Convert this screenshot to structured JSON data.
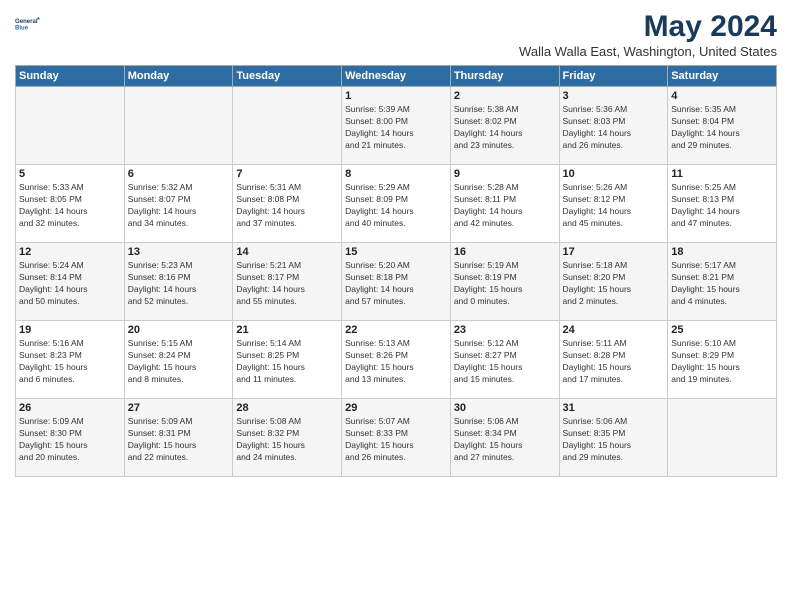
{
  "logo": {
    "line1": "General",
    "line2": "Blue"
  },
  "title": "May 2024",
  "location": "Walla Walla East, Washington, United States",
  "weekdays": [
    "Sunday",
    "Monday",
    "Tuesday",
    "Wednesday",
    "Thursday",
    "Friday",
    "Saturday"
  ],
  "weeks": [
    [
      {
        "day": "",
        "content": ""
      },
      {
        "day": "",
        "content": ""
      },
      {
        "day": "",
        "content": ""
      },
      {
        "day": "1",
        "content": "Sunrise: 5:39 AM\nSunset: 8:00 PM\nDaylight: 14 hours\nand 21 minutes."
      },
      {
        "day": "2",
        "content": "Sunrise: 5:38 AM\nSunset: 8:02 PM\nDaylight: 14 hours\nand 23 minutes."
      },
      {
        "day": "3",
        "content": "Sunrise: 5:36 AM\nSunset: 8:03 PM\nDaylight: 14 hours\nand 26 minutes."
      },
      {
        "day": "4",
        "content": "Sunrise: 5:35 AM\nSunset: 8:04 PM\nDaylight: 14 hours\nand 29 minutes."
      }
    ],
    [
      {
        "day": "5",
        "content": "Sunrise: 5:33 AM\nSunset: 8:05 PM\nDaylight: 14 hours\nand 32 minutes."
      },
      {
        "day": "6",
        "content": "Sunrise: 5:32 AM\nSunset: 8:07 PM\nDaylight: 14 hours\nand 34 minutes."
      },
      {
        "day": "7",
        "content": "Sunrise: 5:31 AM\nSunset: 8:08 PM\nDaylight: 14 hours\nand 37 minutes."
      },
      {
        "day": "8",
        "content": "Sunrise: 5:29 AM\nSunset: 8:09 PM\nDaylight: 14 hours\nand 40 minutes."
      },
      {
        "day": "9",
        "content": "Sunrise: 5:28 AM\nSunset: 8:11 PM\nDaylight: 14 hours\nand 42 minutes."
      },
      {
        "day": "10",
        "content": "Sunrise: 5:26 AM\nSunset: 8:12 PM\nDaylight: 14 hours\nand 45 minutes."
      },
      {
        "day": "11",
        "content": "Sunrise: 5:25 AM\nSunset: 8:13 PM\nDaylight: 14 hours\nand 47 minutes."
      }
    ],
    [
      {
        "day": "12",
        "content": "Sunrise: 5:24 AM\nSunset: 8:14 PM\nDaylight: 14 hours\nand 50 minutes."
      },
      {
        "day": "13",
        "content": "Sunrise: 5:23 AM\nSunset: 8:16 PM\nDaylight: 14 hours\nand 52 minutes."
      },
      {
        "day": "14",
        "content": "Sunrise: 5:21 AM\nSunset: 8:17 PM\nDaylight: 14 hours\nand 55 minutes."
      },
      {
        "day": "15",
        "content": "Sunrise: 5:20 AM\nSunset: 8:18 PM\nDaylight: 14 hours\nand 57 minutes."
      },
      {
        "day": "16",
        "content": "Sunrise: 5:19 AM\nSunset: 8:19 PM\nDaylight: 15 hours\nand 0 minutes."
      },
      {
        "day": "17",
        "content": "Sunrise: 5:18 AM\nSunset: 8:20 PM\nDaylight: 15 hours\nand 2 minutes."
      },
      {
        "day": "18",
        "content": "Sunrise: 5:17 AM\nSunset: 8:21 PM\nDaylight: 15 hours\nand 4 minutes."
      }
    ],
    [
      {
        "day": "19",
        "content": "Sunrise: 5:16 AM\nSunset: 8:23 PM\nDaylight: 15 hours\nand 6 minutes."
      },
      {
        "day": "20",
        "content": "Sunrise: 5:15 AM\nSunset: 8:24 PM\nDaylight: 15 hours\nand 8 minutes."
      },
      {
        "day": "21",
        "content": "Sunrise: 5:14 AM\nSunset: 8:25 PM\nDaylight: 15 hours\nand 11 minutes."
      },
      {
        "day": "22",
        "content": "Sunrise: 5:13 AM\nSunset: 8:26 PM\nDaylight: 15 hours\nand 13 minutes."
      },
      {
        "day": "23",
        "content": "Sunrise: 5:12 AM\nSunset: 8:27 PM\nDaylight: 15 hours\nand 15 minutes."
      },
      {
        "day": "24",
        "content": "Sunrise: 5:11 AM\nSunset: 8:28 PM\nDaylight: 15 hours\nand 17 minutes."
      },
      {
        "day": "25",
        "content": "Sunrise: 5:10 AM\nSunset: 8:29 PM\nDaylight: 15 hours\nand 19 minutes."
      }
    ],
    [
      {
        "day": "26",
        "content": "Sunrise: 5:09 AM\nSunset: 8:30 PM\nDaylight: 15 hours\nand 20 minutes."
      },
      {
        "day": "27",
        "content": "Sunrise: 5:09 AM\nSunset: 8:31 PM\nDaylight: 15 hours\nand 22 minutes."
      },
      {
        "day": "28",
        "content": "Sunrise: 5:08 AM\nSunset: 8:32 PM\nDaylight: 15 hours\nand 24 minutes."
      },
      {
        "day": "29",
        "content": "Sunrise: 5:07 AM\nSunset: 8:33 PM\nDaylight: 15 hours\nand 26 minutes."
      },
      {
        "day": "30",
        "content": "Sunrise: 5:06 AM\nSunset: 8:34 PM\nDaylight: 15 hours\nand 27 minutes."
      },
      {
        "day": "31",
        "content": "Sunrise: 5:06 AM\nSunset: 8:35 PM\nDaylight: 15 hours\nand 29 minutes."
      },
      {
        "day": "",
        "content": ""
      }
    ]
  ]
}
